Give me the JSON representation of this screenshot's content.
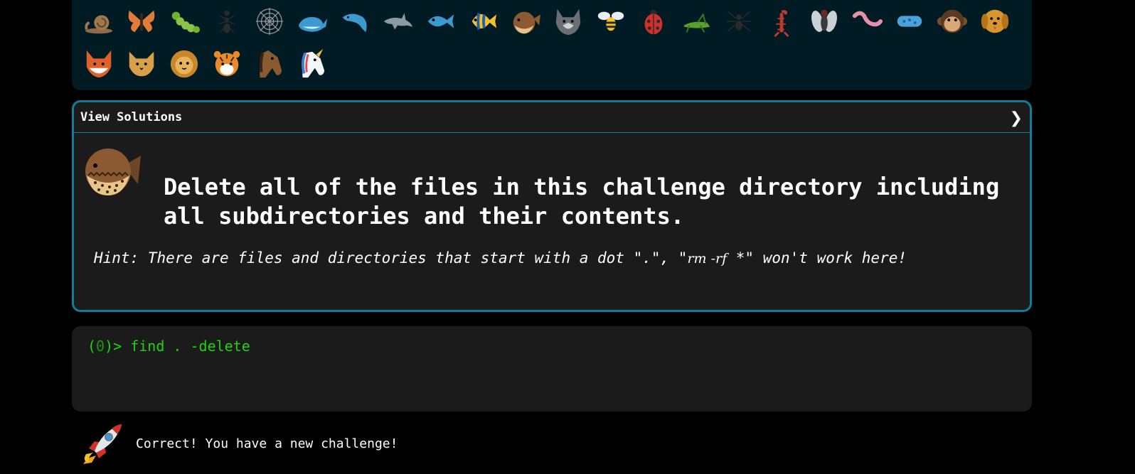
{
  "emoji_grid": {
    "row1": [
      "snail-icon",
      "butterfly-icon",
      "caterpillar-icon",
      "ant-icon",
      "spider-web-icon",
      "whale-icon",
      "spouting-dolphin-icon",
      "dolphin-icon",
      "fish-icon",
      "tropical-fish-icon",
      "blowfish-icon",
      "wolf-icon",
      "bee-icon",
      "ladybug-icon",
      "cricket-icon",
      "spider-icon",
      "scorpion-icon",
      "fly-icon",
      "worm-icon",
      "microbe-icon",
      "monkey-face-icon",
      "dog-face-icon"
    ],
    "row2": [
      "fox-icon",
      "cat-face-icon",
      "lion-icon",
      "tiger-face-icon",
      "horse-face-icon",
      "unicorn-icon"
    ]
  },
  "challenge": {
    "header_title": "View Solutions",
    "header_chevron": "❯",
    "avatar_icon": "blowfish-icon",
    "task": "Delete all of the files in this challenge directory including all subdirectories and their contents.",
    "hint_before": "Hint: There are files and directories that start with a dot \".\", \"",
    "hint_code": "rm -rf",
    "hint_after": " *\" won't work here!"
  },
  "terminal": {
    "prompt_open": "(",
    "exit_code": "0",
    "prompt_close": ")> ",
    "command": "find . -delete"
  },
  "status": {
    "icon": "rocket-icon",
    "message": "Correct! You have a new challenge!"
  },
  "colors": {
    "accent": "#0f7c99",
    "terminal_text": "#1fd40b",
    "panel_bg": "#001b24",
    "card_bg": "#1b1b1b"
  }
}
